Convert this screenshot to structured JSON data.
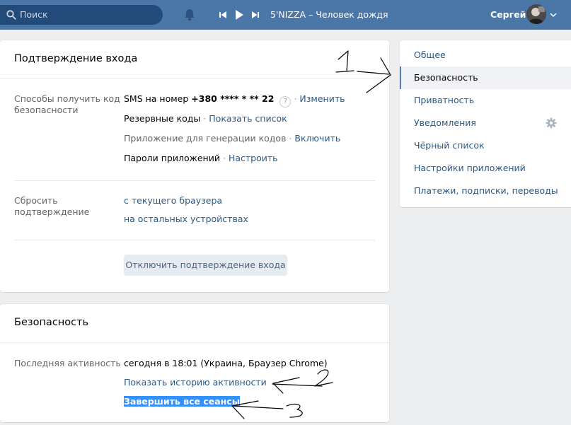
{
  "header": {
    "search_placeholder": "Поиск",
    "track_title": "5'NIZZA – Человек дождя",
    "user_name": "Сергей"
  },
  "login_confirm": {
    "title": "Подтверждение входа",
    "methods_label": "Способы получить код безопасности",
    "sms_prefix": "SMS на номер ",
    "sms_number": "+380 **** * ** 22",
    "help": "?",
    "change_link": "Изменить",
    "backup_codes": "Резервные коды",
    "show_list_link": "Показать список",
    "app_gen": "Приложение для генерации кодов",
    "enable_link": "Включить",
    "app_passwords": "Пароли приложений",
    "configure_link": "Настроить",
    "reset_label": "Сбросить подтверждение",
    "reset_current": "с текущего браузера",
    "reset_others": "на остальных устройствах",
    "disable_button": "Отключить подтверждение входа"
  },
  "security": {
    "title": "Безопасность",
    "last_activity_label": "Последняя активность",
    "last_activity_value": "сегодня в 18:01 (Украина, Браузер Chrome)",
    "show_history_link": "Показать историю активности",
    "end_sessions_link": "Завершить все сеансы"
  },
  "menu": {
    "items": [
      {
        "label": "Общее"
      },
      {
        "label": "Безопасность",
        "active": true
      },
      {
        "label": "Приватность"
      },
      {
        "label": "Уведомления"
      },
      {
        "label": "Чёрный список"
      },
      {
        "label": "Настройки приложений"
      },
      {
        "label": "Платежи, подписки, переводы"
      }
    ]
  },
  "annotations": [
    "1",
    "2",
    "3"
  ],
  "colors": {
    "topbar": "#4a76a8",
    "link": "#2a5885",
    "selection": "#3390ff"
  }
}
